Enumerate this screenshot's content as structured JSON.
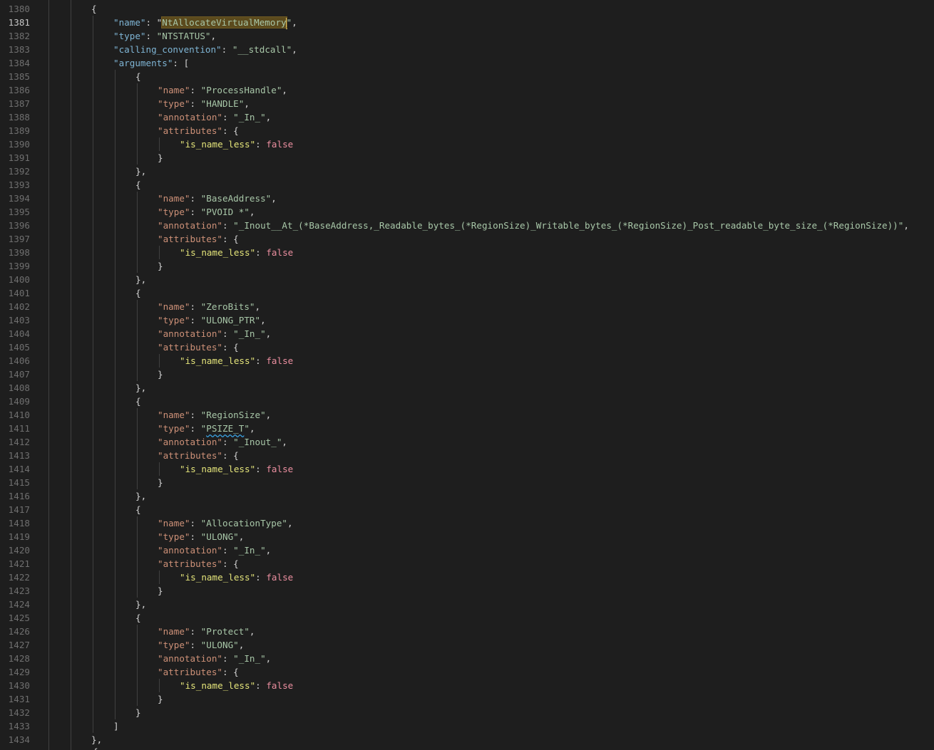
{
  "lines": [
    {
      "n": "1380",
      "indent": 2,
      "tokens": [
        [
          "p",
          "{"
        ]
      ]
    },
    {
      "n": "1381",
      "indent": 3,
      "active": true,
      "tokens": [
        [
          "k",
          "\"name\""
        ],
        [
          "p",
          ": \""
        ],
        [
          "hl",
          "NtAllocateVirtualMemory"
        ],
        [
          "cursor",
          ""
        ],
        [
          "s",
          "\""
        ],
        [
          "p",
          ","
        ]
      ]
    },
    {
      "n": "1382",
      "indent": 3,
      "tokens": [
        [
          "k",
          "\"type\""
        ],
        [
          "p",
          ": "
        ],
        [
          "s",
          "\"NTSTATUS\""
        ],
        [
          "p",
          ","
        ]
      ]
    },
    {
      "n": "1383",
      "indent": 3,
      "tokens": [
        [
          "k",
          "\"calling_convention\""
        ],
        [
          "p",
          ": "
        ],
        [
          "s",
          "\"__stdcall\""
        ],
        [
          "p",
          ","
        ]
      ]
    },
    {
      "n": "1384",
      "indent": 3,
      "tokens": [
        [
          "k",
          "\"arguments\""
        ],
        [
          "p",
          ": ["
        ]
      ]
    },
    {
      "n": "1385",
      "indent": 4,
      "tokens": [
        [
          "p",
          "{"
        ]
      ]
    },
    {
      "n": "1386",
      "indent": 5,
      "tokens": [
        [
          "ks",
          "\"name\""
        ],
        [
          "p",
          ": "
        ],
        [
          "s",
          "\"ProcessHandle\""
        ],
        [
          "p",
          ","
        ]
      ]
    },
    {
      "n": "1387",
      "indent": 5,
      "tokens": [
        [
          "ks",
          "\"type\""
        ],
        [
          "p",
          ": "
        ],
        [
          "s",
          "\"HANDLE\""
        ],
        [
          "p",
          ","
        ]
      ]
    },
    {
      "n": "1388",
      "indent": 5,
      "tokens": [
        [
          "ks",
          "\"annotation\""
        ],
        [
          "p",
          ": "
        ],
        [
          "s",
          "\"_In_\""
        ],
        [
          "p",
          ","
        ]
      ]
    },
    {
      "n": "1389",
      "indent": 5,
      "tokens": [
        [
          "ks",
          "\"attributes\""
        ],
        [
          "p",
          ": {"
        ]
      ]
    },
    {
      "n": "1390",
      "indent": 6,
      "tokens": [
        [
          "ky",
          "\"is_name_less\""
        ],
        [
          "p",
          ": "
        ],
        [
          "b",
          "false"
        ]
      ]
    },
    {
      "n": "1391",
      "indent": 5,
      "tokens": [
        [
          "p",
          "}"
        ]
      ]
    },
    {
      "n": "1392",
      "indent": 4,
      "tokens": [
        [
          "p",
          "},"
        ]
      ]
    },
    {
      "n": "1393",
      "indent": 4,
      "tokens": [
        [
          "p",
          "{"
        ]
      ]
    },
    {
      "n": "1394",
      "indent": 5,
      "tokens": [
        [
          "ks",
          "\"name\""
        ],
        [
          "p",
          ": "
        ],
        [
          "s",
          "\"BaseAddress\""
        ],
        [
          "p",
          ","
        ]
      ]
    },
    {
      "n": "1395",
      "indent": 5,
      "tokens": [
        [
          "ks",
          "\"type\""
        ],
        [
          "p",
          ": "
        ],
        [
          "s",
          "\"PVOID *\""
        ],
        [
          "p",
          ","
        ]
      ]
    },
    {
      "n": "1396",
      "indent": 5,
      "tokens": [
        [
          "ks",
          "\"annotation\""
        ],
        [
          "p",
          ": "
        ],
        [
          "s",
          "\"_Inout__At_(*BaseAddress,_Readable_bytes_(*RegionSize)_Writable_bytes_(*RegionSize)_Post_readable_byte_size_(*RegionSize))\""
        ],
        [
          "p",
          ","
        ]
      ]
    },
    {
      "n": "1397",
      "indent": 5,
      "tokens": [
        [
          "ks",
          "\"attributes\""
        ],
        [
          "p",
          ": {"
        ]
      ]
    },
    {
      "n": "1398",
      "indent": 6,
      "tokens": [
        [
          "ky",
          "\"is_name_less\""
        ],
        [
          "p",
          ": "
        ],
        [
          "b",
          "false"
        ]
      ]
    },
    {
      "n": "1399",
      "indent": 5,
      "tokens": [
        [
          "p",
          "}"
        ]
      ]
    },
    {
      "n": "1400",
      "indent": 4,
      "tokens": [
        [
          "p",
          "},"
        ]
      ]
    },
    {
      "n": "1401",
      "indent": 4,
      "tokens": [
        [
          "p",
          "{"
        ]
      ]
    },
    {
      "n": "1402",
      "indent": 5,
      "tokens": [
        [
          "ks",
          "\"name\""
        ],
        [
          "p",
          ": "
        ],
        [
          "s",
          "\"ZeroBits\""
        ],
        [
          "p",
          ","
        ]
      ]
    },
    {
      "n": "1403",
      "indent": 5,
      "tokens": [
        [
          "ks",
          "\"type\""
        ],
        [
          "p",
          ": "
        ],
        [
          "s",
          "\"ULONG_PTR\""
        ],
        [
          "p",
          ","
        ]
      ]
    },
    {
      "n": "1404",
      "indent": 5,
      "tokens": [
        [
          "ks",
          "\"annotation\""
        ],
        [
          "p",
          ": "
        ],
        [
          "s",
          "\"_In_\""
        ],
        [
          "p",
          ","
        ]
      ]
    },
    {
      "n": "1405",
      "indent": 5,
      "tokens": [
        [
          "ks",
          "\"attributes\""
        ],
        [
          "p",
          ": {"
        ]
      ]
    },
    {
      "n": "1406",
      "indent": 6,
      "tokens": [
        [
          "ky",
          "\"is_name_less\""
        ],
        [
          "p",
          ": "
        ],
        [
          "b",
          "false"
        ]
      ]
    },
    {
      "n": "1407",
      "indent": 5,
      "tokens": [
        [
          "p",
          "}"
        ]
      ]
    },
    {
      "n": "1408",
      "indent": 4,
      "tokens": [
        [
          "p",
          "},"
        ]
      ]
    },
    {
      "n": "1409",
      "indent": 4,
      "tokens": [
        [
          "p",
          "{"
        ]
      ]
    },
    {
      "n": "1410",
      "indent": 5,
      "tokens": [
        [
          "ks",
          "\"name\""
        ],
        [
          "p",
          ": "
        ],
        [
          "s",
          "\"RegionSize\""
        ],
        [
          "p",
          ","
        ]
      ]
    },
    {
      "n": "1411",
      "indent": 5,
      "tokens": [
        [
          "ks",
          "\"type\""
        ],
        [
          "p",
          ": "
        ],
        [
          "s",
          "\""
        ],
        [
          "sq",
          "PSIZE_T"
        ],
        [
          "s",
          "\""
        ],
        [
          "p",
          ","
        ]
      ]
    },
    {
      "n": "1412",
      "indent": 5,
      "tokens": [
        [
          "ks",
          "\"annotation\""
        ],
        [
          "p",
          ": "
        ],
        [
          "s",
          "\"_Inout_\""
        ],
        [
          "p",
          ","
        ]
      ]
    },
    {
      "n": "1413",
      "indent": 5,
      "tokens": [
        [
          "ks",
          "\"attributes\""
        ],
        [
          "p",
          ": {"
        ]
      ]
    },
    {
      "n": "1414",
      "indent": 6,
      "tokens": [
        [
          "ky",
          "\"is_name_less\""
        ],
        [
          "p",
          ": "
        ],
        [
          "b",
          "false"
        ]
      ]
    },
    {
      "n": "1415",
      "indent": 5,
      "tokens": [
        [
          "p",
          "}"
        ]
      ]
    },
    {
      "n": "1416",
      "indent": 4,
      "tokens": [
        [
          "p",
          "},"
        ]
      ]
    },
    {
      "n": "1417",
      "indent": 4,
      "tokens": [
        [
          "p",
          "{"
        ]
      ]
    },
    {
      "n": "1418",
      "indent": 5,
      "tokens": [
        [
          "ks",
          "\"name\""
        ],
        [
          "p",
          ": "
        ],
        [
          "s",
          "\"AllocationType\""
        ],
        [
          "p",
          ","
        ]
      ]
    },
    {
      "n": "1419",
      "indent": 5,
      "tokens": [
        [
          "ks",
          "\"type\""
        ],
        [
          "p",
          ": "
        ],
        [
          "s",
          "\"ULONG\""
        ],
        [
          "p",
          ","
        ]
      ]
    },
    {
      "n": "1420",
      "indent": 5,
      "tokens": [
        [
          "ks",
          "\"annotation\""
        ],
        [
          "p",
          ": "
        ],
        [
          "s",
          "\"_In_\""
        ],
        [
          "p",
          ","
        ]
      ]
    },
    {
      "n": "1421",
      "indent": 5,
      "tokens": [
        [
          "ks",
          "\"attributes\""
        ],
        [
          "p",
          ": {"
        ]
      ]
    },
    {
      "n": "1422",
      "indent": 6,
      "tokens": [
        [
          "ky",
          "\"is_name_less\""
        ],
        [
          "p",
          ": "
        ],
        [
          "b",
          "false"
        ]
      ]
    },
    {
      "n": "1423",
      "indent": 5,
      "tokens": [
        [
          "p",
          "}"
        ]
      ]
    },
    {
      "n": "1424",
      "indent": 4,
      "tokens": [
        [
          "p",
          "},"
        ]
      ]
    },
    {
      "n": "1425",
      "indent": 4,
      "tokens": [
        [
          "p",
          "{"
        ]
      ]
    },
    {
      "n": "1426",
      "indent": 5,
      "tokens": [
        [
          "ks",
          "\"name\""
        ],
        [
          "p",
          ": "
        ],
        [
          "s",
          "\"Protect\""
        ],
        [
          "p",
          ","
        ]
      ]
    },
    {
      "n": "1427",
      "indent": 5,
      "tokens": [
        [
          "ks",
          "\"type\""
        ],
        [
          "p",
          ": "
        ],
        [
          "s",
          "\"ULONG\""
        ],
        [
          "p",
          ","
        ]
      ]
    },
    {
      "n": "1428",
      "indent": 5,
      "tokens": [
        [
          "ks",
          "\"annotation\""
        ],
        [
          "p",
          ": "
        ],
        [
          "s",
          "\"_In_\""
        ],
        [
          "p",
          ","
        ]
      ]
    },
    {
      "n": "1429",
      "indent": 5,
      "tokens": [
        [
          "ks",
          "\"attributes\""
        ],
        [
          "p",
          ": {"
        ]
      ]
    },
    {
      "n": "1430",
      "indent": 6,
      "tokens": [
        [
          "ky",
          "\"is_name_less\""
        ],
        [
          "p",
          ": "
        ],
        [
          "b",
          "false"
        ]
      ]
    },
    {
      "n": "1431",
      "indent": 5,
      "tokens": [
        [
          "p",
          "}"
        ]
      ]
    },
    {
      "n": "1432",
      "indent": 4,
      "tokens": [
        [
          "p",
          "}"
        ]
      ]
    },
    {
      "n": "1433",
      "indent": 3,
      "tokens": [
        [
          "p",
          "]"
        ]
      ]
    },
    {
      "n": "1434",
      "indent": 2,
      "tokens": [
        [
          "p",
          "},"
        ]
      ]
    }
  ],
  "colors": {
    "background": "#1e1e1e",
    "key": "#ce9178",
    "string": "#a8c7a8",
    "boolean": "#ec8fa0",
    "nested_key": "#e4e47a",
    "line_number": "#6f6f6f",
    "selection": "#5b4a1d"
  }
}
